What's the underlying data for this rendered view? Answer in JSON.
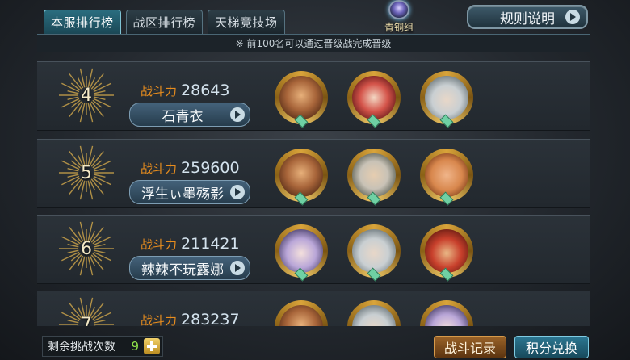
{
  "tabs": [
    "本服排行榜",
    "战区排行榜",
    "天梯竞技场"
  ],
  "badge": {
    "label": "青铜组"
  },
  "rules_button": "规则说明",
  "notice": "※ 前100名可以通过晋级战完成晋级",
  "power_label": "战斗力",
  "rows": [
    {
      "rank": "4",
      "power": "28643",
      "name": "石青衣",
      "heroes": [
        "warrior-hero-avatar",
        "armored-lady-hero-avatar",
        "white-hair-hero-avatar"
      ]
    },
    {
      "rank": "5",
      "power": "259600",
      "name": "浮生ぃ墨殇影",
      "heroes": [
        "warrior-hero-avatar",
        "silver-hair-swordsman-avatar",
        "laughing-monk-avatar"
      ]
    },
    {
      "rank": "6",
      "power": "211421",
      "name": "辣辣不玩露娜",
      "heroes": [
        "fox-spirit-girl-avatar",
        "white-hair-hero-avatar",
        "monkey-king-avatar"
      ]
    },
    {
      "rank": "7",
      "power": "283237",
      "name": "",
      "heroes": [
        "warrior-hero-avatar",
        "white-hair-hero-avatar",
        "fox-spirit-girl-avatar"
      ]
    }
  ],
  "footer": {
    "attempts_label": "剩余挑战次数",
    "attempts_count": "9",
    "battle_log": "战斗记录",
    "points_exchange": "积分兑换"
  },
  "colors": {
    "accent_orange": "#e88d1e",
    "count_green": "#8fe24a",
    "tab_active": "#2a6d7f"
  }
}
